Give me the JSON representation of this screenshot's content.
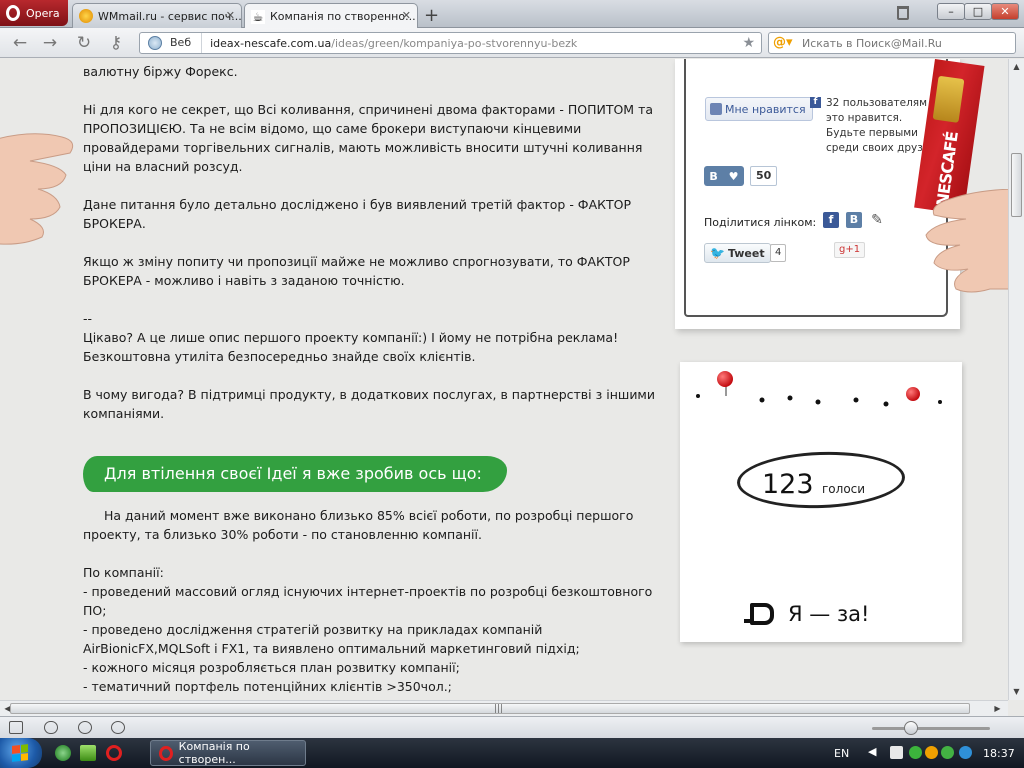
{
  "browser": {
    "opera_button": "Opera",
    "tabs": [
      {
        "title": "WMmail.ru - сервис поч...",
        "active": false
      },
      {
        "title": "Компанія по створенно...",
        "active": true
      }
    ],
    "address": {
      "web_label": "Веб",
      "url_host": "ideax-nescafe.com.ua",
      "url_path": "/ideas/green/kompaniya-po-stvorennyu-bezk"
    },
    "search": {
      "placeholder": "Искать в Поиск@Mail.Ru"
    }
  },
  "article": {
    "p1": "валютну біржу Форекс.",
    "p2": "Ні для кого не секрет, що Всі коливання, спричинені двома факторами - ПОПИТОМ та ПРОПОЗИЦІЄЮ. Та не всім відомо, що саме брокери виступаючи кінцевими провайдерами торгівельних сигналів, мають можливість вносити штучні коливання ціни на власний розсуд.",
    "p3": "Дане питання було детально досліджено і був виявлений третій фактор - ФАКТОР БРОКЕРА.",
    "p4": "Якщо ж зміну попиту чи пропозиції майже не можливо спрогнозувати, то ФАКТОР БРОКЕРА - можливо і навіть з заданою точністю.",
    "p5_lines": [
      "--",
      "Цікаво? А це лише опис першого проекту компанії:) І йому не потрібна реклама!",
      "Безкоштовна утиліта безпосередньо знайде своїх клієнтів."
    ],
    "p6": "В чому вигода? В підтримці продукту, в додаткових послугах, в партнерстві з іншими компаніями.",
    "banner": "Для втілення своєї Ідеї я вже зробив ось що:",
    "p7": "На даний момент вже виконано близько 85% всієї роботи, по розробці першого проекту, та близько 30% роботи - по становленню компанії.",
    "p8_lines": [
      "По компанії:",
      "- проведений массовий огляд існуючих інтернет-проектів по розробці безкоштовного ПО;",
      "- проведено дослідження стратегій розвитку на прикладах компаній AirBionicFX,MQLSoft і FX1, та виявлено оптимальний маркетинговий підхід;",
      "- кожного місяця розробляється план розвитку компанії;",
      "- тематичний портфель потенційних клієнтів >350чол.;"
    ]
  },
  "social": {
    "like_button": "Мне нравится",
    "like_text": "32 пользователям это нравится. Будьте первыми среди своих друзей.",
    "vk_label": "В",
    "vk_count": "50",
    "share_label": "Поділитися лінком:",
    "tweet_label": "Tweet",
    "tweet_count": "4",
    "gplus_label": "+1",
    "pack_brand": "NESCAFÉ"
  },
  "votes": {
    "count": "123",
    "label": "голоси",
    "vote_button": "Я — за!"
  },
  "taskbar": {
    "task_title": "Компанія по створен...",
    "lang": "EN",
    "clock": "18:37"
  },
  "colors": {
    "banner_green": "#33a040",
    "opera_red": "#b8282d",
    "pin_red": "#c40d12"
  }
}
